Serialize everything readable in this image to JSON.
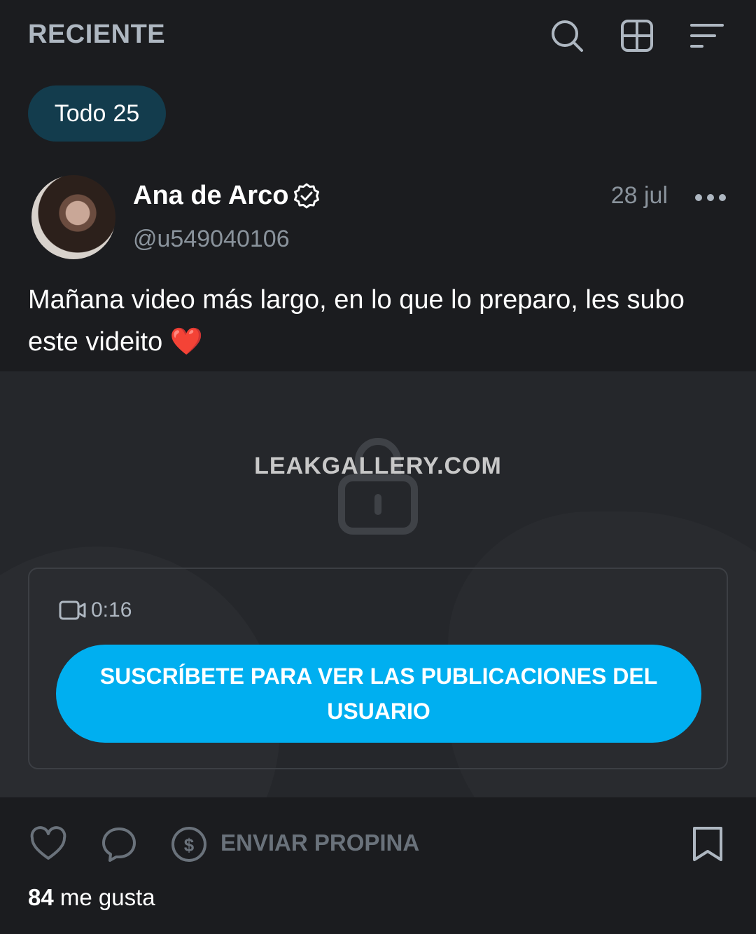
{
  "header": {
    "title": "RECIENTE",
    "icons": [
      "search-icon",
      "grid-icon",
      "sort-icon"
    ]
  },
  "filter": {
    "label": "Todo",
    "count": "25"
  },
  "post": {
    "author": "Ana de Arco",
    "handle": "@u549040106",
    "date": "28 jul",
    "text": "Mañana video más largo, en lo que lo preparo, les subo este videito",
    "emoji": "❤️",
    "media": {
      "watermark": "LEAKGALLERY.COM",
      "video_duration": "0:16",
      "subscribe_label": "SUSCRÍBETE PARA VER LAS PUBLICACIONES DEL USUARIO"
    },
    "actions": {
      "tip_label": "ENVIAR PROPINA"
    },
    "likes": {
      "count": "84",
      "label": "me gusta"
    }
  },
  "colors": {
    "background": "#1b1c1f",
    "accent": "#00aff0",
    "pill": "#133c4d",
    "muted": "#8a939c"
  }
}
